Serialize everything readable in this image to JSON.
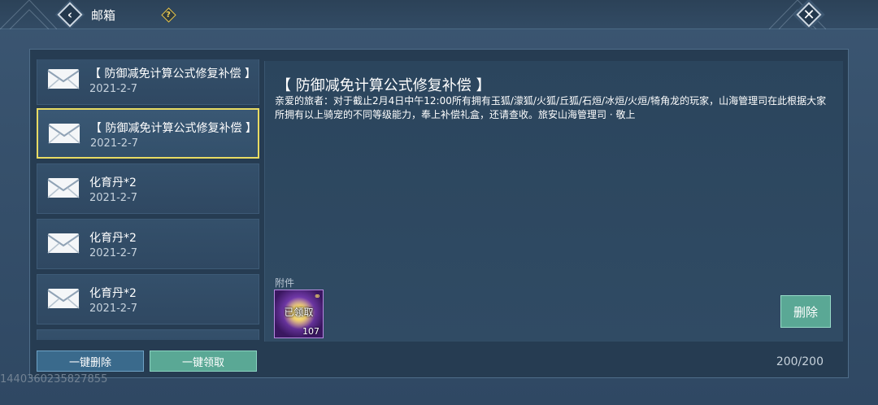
{
  "header": {
    "title": "邮箱",
    "help_glyph": "?",
    "back_icon": "back-chevron-icon",
    "close_icon": "close-icon"
  },
  "mail_list": [
    {
      "subject": "【 防御减免计算公式修复补偿 】",
      "date": "2021-2-7",
      "selected": false
    },
    {
      "subject": "【 防御减免计算公式修复补偿 】",
      "date": "2021-2-7",
      "selected": true
    },
    {
      "subject": "化育丹*2",
      "date": "2021-2-7",
      "selected": false
    },
    {
      "subject": "化育丹*2",
      "date": "2021-2-7",
      "selected": false
    },
    {
      "subject": "化育丹*2",
      "date": "2021-2-7",
      "selected": false
    }
  ],
  "detail": {
    "title": "【 防御减免计算公式修复补偿 】",
    "body": "亲爱的旅者：对于截止2月4日中午12:00所有拥有玉狐/濛狐/火狐/丘狐/石烜/冰烜/火烜/犄角龙的玩家，山海管理司在此根据大家所拥有以上骑宠的不同等级能力，奉上补偿礼盒，还请查收。旅安山海管理司 · 敬上",
    "attachment_label": "附件",
    "attachment": {
      "status": "已领取",
      "quantity": "107"
    },
    "delete_label": "删除"
  },
  "footer": {
    "delete_all_label": "一键删除",
    "claim_all_label": "一键领取",
    "count": "200/200",
    "account_id": "1440360235827855"
  },
  "colors": {
    "selected_border": "#e8db63",
    "teal_button": "#5aa895",
    "blue_button": "#3a6a8c"
  }
}
